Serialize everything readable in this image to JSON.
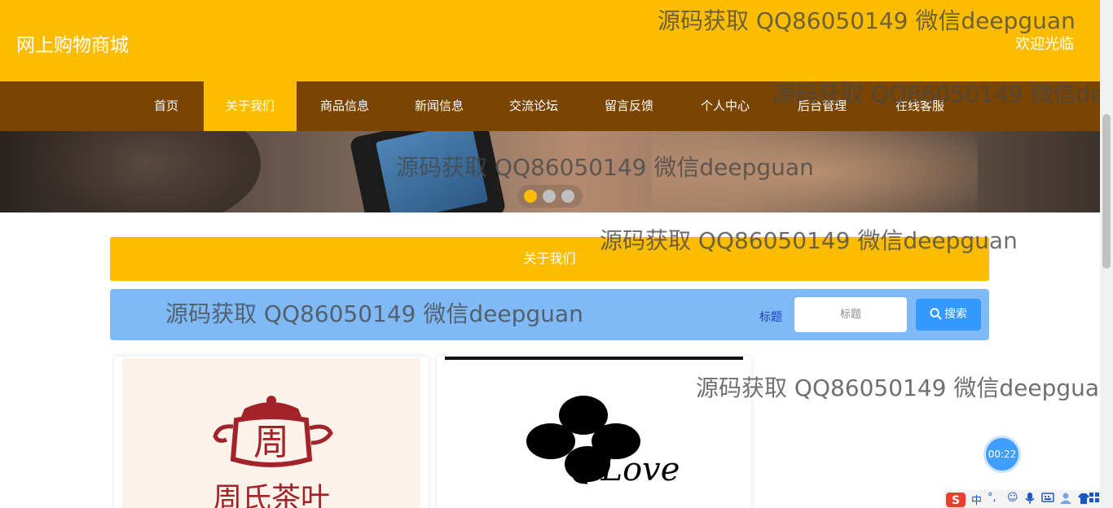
{
  "header": {
    "site_title": "网上购物商城",
    "welcome": "欢迎光临"
  },
  "nav": {
    "items": [
      {
        "label": "首页"
      },
      {
        "label": "关于我们"
      },
      {
        "label": "商品信息"
      },
      {
        "label": "新闻信息"
      },
      {
        "label": "交流论坛"
      },
      {
        "label": "留言反馈"
      },
      {
        "label": "个人中心"
      },
      {
        "label": "后台管理"
      },
      {
        "label": "在线客服"
      }
    ],
    "active": "关于我们"
  },
  "carousel": {
    "slide_count": 3,
    "active_slide": 1
  },
  "section": {
    "title": "关于我们"
  },
  "search": {
    "label": "标题",
    "placeholder": "标题",
    "value": "",
    "button_label": "搜索"
  },
  "cards": [
    {
      "logo_text": "周氏茶叶",
      "logo_char": "周"
    },
    {
      "logo_text": "Love"
    }
  ],
  "watermark": {
    "text": "源码获取 QQ86050149 微信deepguan",
    "text_cut": "源码获取 QQ86050149 微信de",
    "text_cut2": "源码获取 QQ86050149 微信deepgua"
  },
  "timer": {
    "value": "00:22"
  },
  "ime": {
    "lang": "中",
    "punct": "°,"
  },
  "colors": {
    "primary": "#fcbd00",
    "nav_bg": "#7a4503",
    "search_bg": "#7fbaf6",
    "button": "#3399ff"
  }
}
